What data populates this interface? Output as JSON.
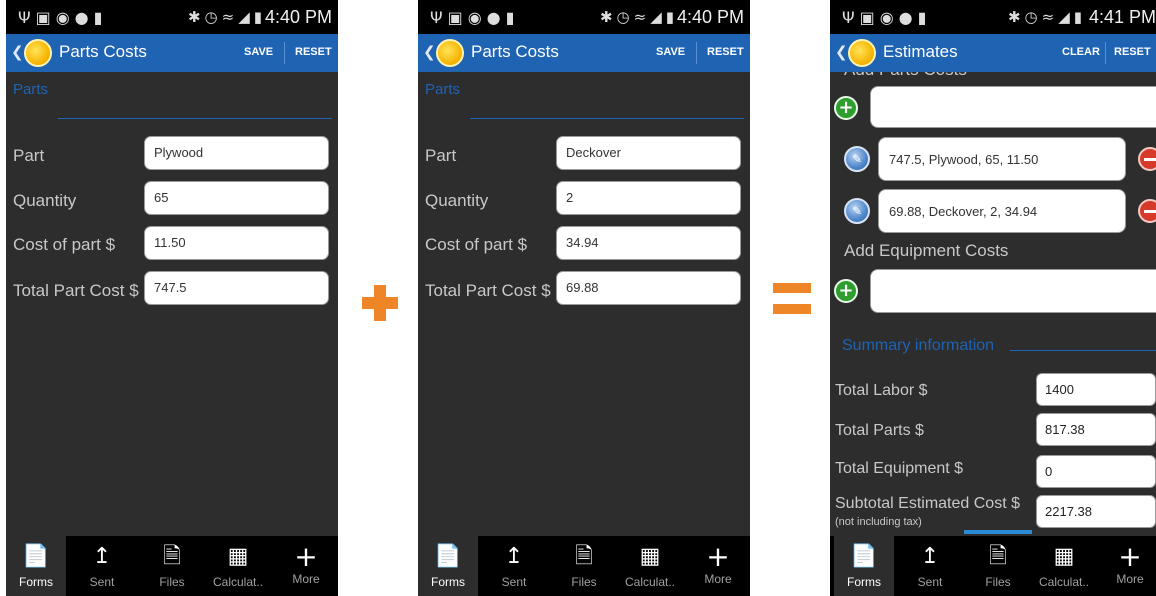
{
  "status_bar": {
    "time_1": "4:40 PM",
    "time_2": "4:40 PM",
    "time_3": "4:41 PM"
  },
  "screen1": {
    "title": "Parts Costs",
    "actions": [
      "SAVE",
      "RESET"
    ],
    "section": "Parts",
    "fields": [
      {
        "label": "Part",
        "value": "Plywood"
      },
      {
        "label": "Quantity",
        "value": "65"
      },
      {
        "label": "Cost of part $",
        "value": "11.50"
      },
      {
        "label": "Total Part Cost $",
        "value": "747.5"
      }
    ]
  },
  "screen2": {
    "title": "Parts Costs",
    "actions": [
      "SAVE",
      "RESET"
    ],
    "section": "Parts",
    "fields": [
      {
        "label": "Part",
        "value": "Deckover"
      },
      {
        "label": "Quantity",
        "value": "2"
      },
      {
        "label": "Cost of part $",
        "value": "34.94"
      },
      {
        "label": "Total Part Cost $",
        "value": "69.88"
      }
    ]
  },
  "screen3": {
    "title": "Estimates",
    "actions": [
      "CLEAR",
      "RESET"
    ],
    "parts_heading": "Add Parts Costs",
    "parts_entries": [
      "747.5, Plywood, 65, 11.50",
      "69.88, Deckover, 2, 34.94"
    ],
    "equipment_heading": "Add Equipment Costs",
    "summary_heading": "Summary information",
    "summary": [
      {
        "label": "Total Labor $",
        "value": "1400"
      },
      {
        "label": "Total Parts $",
        "value": "817.38"
      },
      {
        "label": "Total Equipment $",
        "value": "0"
      },
      {
        "label": "Subtotal Estimated Cost $",
        "sublabel": "(not including tax)",
        "value": "2217.38"
      }
    ]
  },
  "bottom_nav": [
    {
      "label": "Forms",
      "icon": "forms-icon",
      "active": true
    },
    {
      "label": "Sent",
      "icon": "upload-icon"
    },
    {
      "label": "Files",
      "icon": "pdf-file-icon"
    },
    {
      "label": "Calculat..",
      "icon": "calculator-icon"
    },
    {
      "label": "More",
      "icon": "plus-icon"
    }
  ],
  "colors": {
    "action_bar": "#1f63b3",
    "background": "#2d2d2d",
    "operator": "#ee8628",
    "accent_blue": "#2a8bd6"
  }
}
